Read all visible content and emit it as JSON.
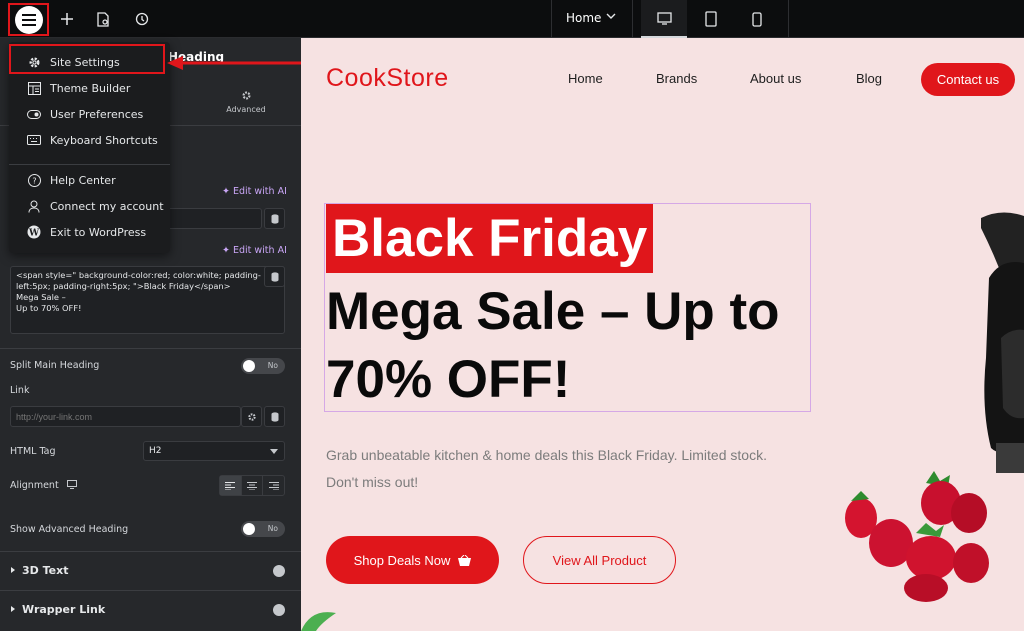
{
  "topbar": {
    "page_select": "Home",
    "devices": [
      "desktop-icon",
      "tablet-icon",
      "mobile-icon"
    ]
  },
  "panel": {
    "title_fragment": "Heading",
    "tab_advanced": "Advanced",
    "edit_ai_1": "✦ Edit with AI",
    "edit_ai_2": "✦ Edit with AI",
    "heading_text": "<span style=\" background-color:red; color:white; padding-left:5px; padding-right:5px; \">Black Friday</span>\nMega Sale –\nUp to 70% OFF!",
    "split_label": "Split Main Heading",
    "split_value": "No",
    "link_label": "Link",
    "link_placeholder": "http://your-link.com",
    "html_tag_label": "HTML Tag",
    "html_tag_value": "H2",
    "alignment_label": "Alignment",
    "adv_heading_label": "Show Advanced Heading",
    "adv_heading_value": "No",
    "section_3d": "3D Text",
    "section_wrapper": "Wrapper Link"
  },
  "menu": {
    "items": [
      {
        "label": "Site Settings",
        "icon": "gear-icon"
      },
      {
        "label": "Theme Builder",
        "icon": "theme-builder-icon"
      },
      {
        "label": "User Preferences",
        "icon": "toggle-icon"
      },
      {
        "label": "Keyboard Shortcuts",
        "icon": "keyboard-icon"
      },
      {
        "label": "Help Center",
        "icon": "help-icon"
      },
      {
        "label": "Connect my account",
        "icon": "user-icon"
      },
      {
        "label": "Exit to WordPress",
        "icon": "wordpress-icon"
      }
    ]
  },
  "site": {
    "logo": "CookStore",
    "nav": [
      "Home",
      "Brands",
      "About us",
      "Blog"
    ],
    "contact": "Contact us",
    "headline_highlight": "Black Friday",
    "headline_rest": "Mega Sale – Up to 70% OFF!",
    "subtext": "Grab unbeatable kitchen & home deals this Black Friday. Limited stock. Don't miss out!",
    "btn_primary": "Shop Deals Now",
    "btn_secondary": "View All Product"
  },
  "colors": {
    "accent_red": "#e0161b",
    "ai_purple": "#c9a6f6",
    "hero_bg": "#f6e2e2"
  }
}
